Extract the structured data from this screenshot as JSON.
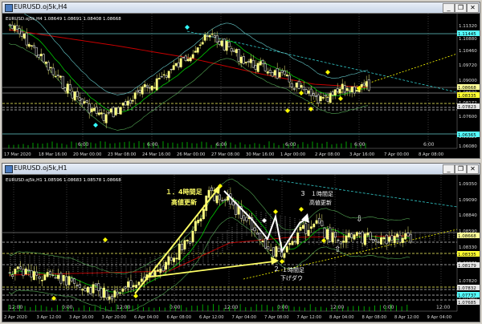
{
  "colors": {
    "bg": "#000000",
    "candle_up": "#ffff80",
    "candle_down": "#ffffff",
    "wick": "#cccc66",
    "ma_red": "#c80000",
    "ma_green": "#00c800",
    "band_cyan": "#66cccc",
    "band_green": "#55aa55",
    "trend_yellow": "#ffff00",
    "trend_cyan": "#33cccc",
    "grid": "#3a3a3a",
    "price_box_current": "#ffff99",
    "diamond_yellow": "#ffff00",
    "diamond_cyan": "#33ffff",
    "cloud": "#9a9a9a",
    "annotation": "#ffffff",
    "arrow_yellow": "#ffff66"
  },
  "window_controls": {
    "minimize_icon": "minimize-icon",
    "restore_icon": "restore-icon",
    "close_icon": "close-icon"
  },
  "top": {
    "window_title": "EURUSD.oj5k,H4",
    "info_line": "EURUSD.oj5k,H4  1.08649 1.08691 1.08408 1.08668",
    "price_labels": [
      "1.11320",
      "1.10880",
      "1.10460",
      "1.09720",
      "1.09000",
      "1.08600",
      "1.08172",
      "1.07600",
      "1.06620",
      "1.06080"
    ],
    "marker_labels": [
      {
        "text": "1.11445",
        "kind": "cyan"
      },
      {
        "text": "1.08668",
        "kind": "current"
      },
      {
        "text": "1.08335",
        "kind": "yellow"
      },
      {
        "text": "1.07823",
        "kind": "white"
      },
      {
        "text": "1.06365",
        "kind": "cyan"
      }
    ],
    "time_labels": [
      "17 Mar 2020",
      "18 Mar 16:00",
      "20 Mar 00:00",
      "23 Mar 08:00",
      "24 Mar 16:00",
      "26 Mar 00:00",
      "27 Mar 08:00",
      "30 Mar 16:00",
      "1 Apr 00:00",
      "2 Apr 08:00",
      "3 Apr 16:00",
      "7 Apr 00:00",
      "8 Apr 08:00"
    ],
    "grid_time_labels": [
      "6:00",
      "6:00",
      "6:00",
      "6:00",
      "6:00",
      "6:00"
    ]
  },
  "bottom": {
    "window_title": "EURUSD.oj5k,H1",
    "info_line": "EURUSD.oj5k,H1  1.08596 1.08683 1.08578 1.08668",
    "price_labels": [
      "1.09350",
      "1.09090",
      "1.08840",
      "1.08590",
      "1.08330",
      "1.08070",
      "1.07820",
      "1.07560"
    ],
    "marker_labels": [
      {
        "text": "1.08668",
        "kind": "current"
      },
      {
        "text": "1.08335",
        "kind": "yellow"
      },
      {
        "text": "1.08179",
        "kind": "white"
      },
      {
        "text": "1.07832",
        "kind": "white"
      },
      {
        "text": "1.07737",
        "kind": "cyan"
      },
      {
        "text": "1.07685",
        "kind": "white"
      }
    ],
    "time_labels": [
      "2 Apr 2020",
      "3 Apr 12:00",
      "3 Apr 16:00",
      "3 Apr 20:00",
      "6 Apr 04:00",
      "6 Apr 08:00",
      "6 Apr 12:00",
      "7 Apr 04:00",
      "7 Apr 08:00",
      "7 Apr 12:00",
      "8 Apr 04:00",
      "8 Apr 08:00",
      "8 Apr 12:00",
      "9 Apr 04:00"
    ],
    "grid_time_labels": [
      "12:00",
      "0:00",
      "12:00",
      "0:00",
      "12:00",
      "0:00",
      "12:00",
      "0:00",
      "12:00"
    ],
    "annotations": {
      "a1_line1": "１．4時間足",
      "a1_line2": "高値更新",
      "a2_num": "２",
      "a2_line1": "１時間足",
      "a2_line2": "下げダウ",
      "a3_num": "３",
      "a3_line1": "１時間足",
      "a3_line2": "高値更新"
    }
  }
}
